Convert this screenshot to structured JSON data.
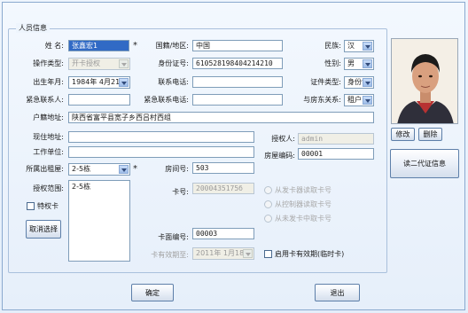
{
  "group_title": "人员信息",
  "labels": {
    "name": "姓   名:",
    "country": "国籍/地区:",
    "ethnic": "民族:",
    "op_type": "操作类型:",
    "id_no": "身份证号:",
    "gender": "性别:",
    "birth": "出生年月:",
    "phone": "联系电话:",
    "id_type": "证件类型:",
    "emergency_contact": "紧急联系人:",
    "emergency_phone": "紧急联系电话:",
    "relation": "与房东关系:",
    "hukou_addr": "户籍地址:",
    "current_addr": "现住地址:",
    "authorizer": "授权人:",
    "work_unit": "工作单位:",
    "house_code": "房屋编码:",
    "building": "所属出租屋:",
    "room_no": "房间号:",
    "auth_scope": "授权范围:",
    "card_no": "卡号:",
    "card_face_no": "卡面编号:",
    "card_expiry": "卡有效期至:"
  },
  "fields": {
    "name": "张鑫宏1",
    "country": "中国",
    "ethnic": "汉",
    "op_type": "开卡授权",
    "id_no": "610528198404214210",
    "gender": "男",
    "birth": "1984年 4月21日",
    "phone": "",
    "id_type": "身份证",
    "emergency_contact": "",
    "emergency_phone": "",
    "relation": "租户",
    "hukou_addr": "陕西省富平县宽子乡西吕村西组",
    "current_addr": "",
    "authorizer": "admin",
    "work_unit": "",
    "house_code": "00001",
    "building": "2-5栋",
    "room_no": "503",
    "card_no": "2000435175б",
    "card_face_no": "00003",
    "card_expiry": "2011年 1月18日"
  },
  "required_mark": "*",
  "auth_scope_items": [
    "2-5栋"
  ],
  "special_card_label": "特权卡",
  "cancel_select_label": "取消选择",
  "read_options": [
    "从发卡器读取卡号",
    "从控制器读取卡号",
    "从未发卡中取卡号"
  ],
  "enable_expiry_label": "启用卡有效期(临时卡)",
  "photo_buttons": {
    "modify": "修改",
    "delete": "删除"
  },
  "read_id_card_label": "读二代证信息",
  "ok_label": "确定",
  "exit_label": "退出"
}
